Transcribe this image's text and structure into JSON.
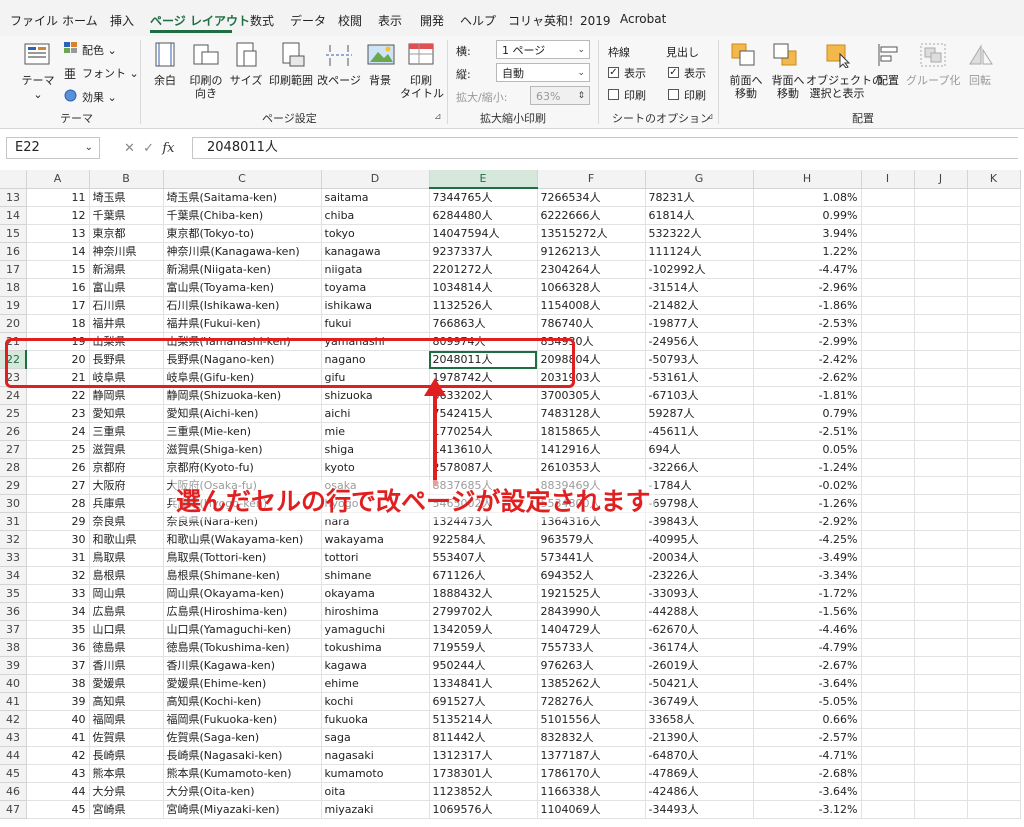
{
  "menu": [
    "ファイル",
    "ホーム",
    "挿入",
    "ページ レイアウト",
    "数式",
    "データ",
    "校閲",
    "表示",
    "開発",
    "ヘルプ",
    "コリャ英和！2019",
    "Acrobat"
  ],
  "active_tab_index": 3,
  "ribbon": {
    "theme": {
      "theme_label": "テーマ",
      "colors": "配色",
      "fonts": "フォント",
      "effects": "効果",
      "group": "テーマ"
    },
    "page_setup": {
      "margins": "余白",
      "orientation": "印刷の\n向き",
      "size": "サイズ",
      "print_area": "印刷範囲",
      "breaks": "改ページ",
      "background": "背景",
      "print_titles": "印刷\nタイトル",
      "group": "ページ設定"
    },
    "scale": {
      "width_label": "横:",
      "width_value": "1 ページ",
      "height_label": "縦:",
      "height_value": "自動",
      "scale_label": "拡大/縮小:",
      "scale_value": "63%",
      "group": "拡大縮小印刷"
    },
    "sheet_options": {
      "gridlines": "枠線",
      "headings": "見出し",
      "view": "表示",
      "print": "印刷",
      "group": "シートのオプション"
    },
    "arrange": {
      "bring_forward": "前面へ\n移動",
      "send_backward": "背面へ\n移動",
      "selection_pane": "オブジェクトの\n選択と表示",
      "align": "配置",
      "group_btn": "グループ化",
      "rotate": "回転",
      "group": "配置"
    }
  },
  "name_box": "E22",
  "formula": "2048011人",
  "columns": [
    "A",
    "B",
    "C",
    "D",
    "E",
    "F",
    "G",
    "H",
    "I",
    "J",
    "K"
  ],
  "selected_column": "E",
  "selected_row": "22",
  "rows": [
    {
      "r": "13",
      "a": "11",
      "b": "埼玉県",
      "c": "埼玉県(Saitama-ken)",
      "d": "saitama",
      "e": "7344765人",
      "f": "7266534人",
      "g": "78231人",
      "h": "1.08%"
    },
    {
      "r": "14",
      "a": "12",
      "b": "千葉県",
      "c": "千葉県(Chiba-ken)",
      "d": "chiba",
      "e": "6284480人",
      "f": "6222666人",
      "g": "61814人",
      "h": "0.99%"
    },
    {
      "r": "15",
      "a": "13",
      "b": "東京都",
      "c": "東京都(Tokyo-to)",
      "d": "tokyo",
      "e": "14047594人",
      "f": "13515272人",
      "g": "532322人",
      "h": "3.94%"
    },
    {
      "r": "16",
      "a": "14",
      "b": "神奈川県",
      "c": "神奈川県(Kanagawa-ken)",
      "d": "kanagawa",
      "e": "9237337人",
      "f": "9126213人",
      "g": "111124人",
      "h": "1.22%"
    },
    {
      "r": "17",
      "a": "15",
      "b": "新潟県",
      "c": "新潟県(Niigata-ken)",
      "d": "niigata",
      "e": "2201272人",
      "f": "2304264人",
      "g": "-102992人",
      "h": "-4.47%"
    },
    {
      "r": "18",
      "a": "16",
      "b": "富山県",
      "c": "富山県(Toyama-ken)",
      "d": "toyama",
      "e": "1034814人",
      "f": "1066328人",
      "g": "-31514人",
      "h": "-2.96%"
    },
    {
      "r": "19",
      "a": "17",
      "b": "石川県",
      "c": "石川県(Ishikawa-ken)",
      "d": "ishikawa",
      "e": "1132526人",
      "f": "1154008人",
      "g": "-21482人",
      "h": "-1.86%"
    },
    {
      "r": "20",
      "a": "18",
      "b": "福井県",
      "c": "福井県(Fukui-ken)",
      "d": "fukui",
      "e": "766863人",
      "f": "786740人",
      "g": "-19877人",
      "h": "-2.53%"
    },
    {
      "r": "21",
      "a": "19",
      "b": "山梨県",
      "c": "山梨県(Yamanashi-ken)",
      "d": "yamanashi",
      "e": "809974人",
      "f": "834930人",
      "g": "-24956人",
      "h": "-2.99%"
    },
    {
      "r": "22",
      "a": "20",
      "b": "長野県",
      "c": "長野県(Nagano-ken)",
      "d": "nagano",
      "e": "2048011人",
      "f": "2098804人",
      "g": "-50793人",
      "h": "-2.42%"
    },
    {
      "r": "23",
      "a": "21",
      "b": "岐阜県",
      "c": "岐阜県(Gifu-ken)",
      "d": "gifu",
      "e": "1978742人",
      "f": "2031903人",
      "g": "-53161人",
      "h": "-2.62%"
    },
    {
      "r": "24",
      "a": "22",
      "b": "静岡県",
      "c": "静岡県(Shizuoka-ken)",
      "d": "shizuoka",
      "e": "3633202人",
      "f": "3700305人",
      "g": "-67103人",
      "h": "-1.81%"
    },
    {
      "r": "25",
      "a": "23",
      "b": "愛知県",
      "c": "愛知県(Aichi-ken)",
      "d": "aichi",
      "e": "7542415人",
      "f": "7483128人",
      "g": "59287人",
      "h": "0.79%"
    },
    {
      "r": "26",
      "a": "24",
      "b": "三重県",
      "c": "三重県(Mie-ken)",
      "d": "mie",
      "e": "1770254人",
      "f": "1815865人",
      "g": "-45611人",
      "h": "-2.51%"
    },
    {
      "r": "27",
      "a": "25",
      "b": "滋賀県",
      "c": "滋賀県(Shiga-ken)",
      "d": "shiga",
      "e": "1413610人",
      "f": "1412916人",
      "g": "694人",
      "h": "0.05%"
    },
    {
      "r": "28",
      "a": "26",
      "b": "京都府",
      "c": "京都府(Kyoto-fu)",
      "d": "kyoto",
      "e": "2578087人",
      "f": "2610353人",
      "g": "-32266人",
      "h": "-1.24%"
    },
    {
      "r": "29",
      "a": "27",
      "b": "大阪府",
      "c": "大阪府(Osaka-fu)",
      "d": "osaka",
      "e": "8837685人",
      "f": "8839469人",
      "g": "-1784人",
      "h": "-0.02%"
    },
    {
      "r": "30",
      "a": "28",
      "b": "兵庫県",
      "c": "兵庫県(Hyogo-ken)",
      "d": "hyogo",
      "e": "5465002人",
      "f": "5534800人",
      "g": "-69798人",
      "h": "-1.26%"
    },
    {
      "r": "31",
      "a": "29",
      "b": "奈良県",
      "c": "奈良県(Nara-ken)",
      "d": "nara",
      "e": "1324473人",
      "f": "1364316人",
      "g": "-39843人",
      "h": "-2.92%"
    },
    {
      "r": "32",
      "a": "30",
      "b": "和歌山県",
      "c": "和歌山県(Wakayama-ken)",
      "d": "wakayama",
      "e": "922584人",
      "f": "963579人",
      "g": "-40995人",
      "h": "-4.25%"
    },
    {
      "r": "33",
      "a": "31",
      "b": "鳥取県",
      "c": "鳥取県(Tottori-ken)",
      "d": "tottori",
      "e": "553407人",
      "f": "573441人",
      "g": "-20034人",
      "h": "-3.49%"
    },
    {
      "r": "34",
      "a": "32",
      "b": "島根県",
      "c": "島根県(Shimane-ken)",
      "d": "shimane",
      "e": "671126人",
      "f": "694352人",
      "g": "-23226人",
      "h": "-3.34%"
    },
    {
      "r": "35",
      "a": "33",
      "b": "岡山県",
      "c": "岡山県(Okayama-ken)",
      "d": "okayama",
      "e": "1888432人",
      "f": "1921525人",
      "g": "-33093人",
      "h": "-1.72%"
    },
    {
      "r": "36",
      "a": "34",
      "b": "広島県",
      "c": "広島県(Hiroshima-ken)",
      "d": "hiroshima",
      "e": "2799702人",
      "f": "2843990人",
      "g": "-44288人",
      "h": "-1.56%"
    },
    {
      "r": "37",
      "a": "35",
      "b": "山口県",
      "c": "山口県(Yamaguchi-ken)",
      "d": "yamaguchi",
      "e": "1342059人",
      "f": "1404729人",
      "g": "-62670人",
      "h": "-4.46%"
    },
    {
      "r": "38",
      "a": "36",
      "b": "徳島県",
      "c": "徳島県(Tokushima-ken)",
      "d": "tokushima",
      "e": "719559人",
      "f": "755733人",
      "g": "-36174人",
      "h": "-4.79%"
    },
    {
      "r": "39",
      "a": "37",
      "b": "香川県",
      "c": "香川県(Kagawa-ken)",
      "d": "kagawa",
      "e": "950244人",
      "f": "976263人",
      "g": "-26019人",
      "h": "-2.67%"
    },
    {
      "r": "40",
      "a": "38",
      "b": "愛媛県",
      "c": "愛媛県(Ehime-ken)",
      "d": "ehime",
      "e": "1334841人",
      "f": "1385262人",
      "g": "-50421人",
      "h": "-3.64%"
    },
    {
      "r": "41",
      "a": "39",
      "b": "高知県",
      "c": "高知県(Kochi-ken)",
      "d": "kochi",
      "e": "691527人",
      "f": "728276人",
      "g": "-36749人",
      "h": "-5.05%"
    },
    {
      "r": "42",
      "a": "40",
      "b": "福岡県",
      "c": "福岡県(Fukuoka-ken)",
      "d": "fukuoka",
      "e": "5135214人",
      "f": "5101556人",
      "g": "33658人",
      "h": "0.66%"
    },
    {
      "r": "43",
      "a": "41",
      "b": "佐賀県",
      "c": "佐賀県(Saga-ken)",
      "d": "saga",
      "e": "811442人",
      "f": "832832人",
      "g": "-21390人",
      "h": "-2.57%"
    },
    {
      "r": "44",
      "a": "42",
      "b": "長崎県",
      "c": "長崎県(Nagasaki-ken)",
      "d": "nagasaki",
      "e": "1312317人",
      "f": "1377187人",
      "g": "-64870人",
      "h": "-4.71%"
    },
    {
      "r": "45",
      "a": "43",
      "b": "熊本県",
      "c": "熊本県(Kumamoto-ken)",
      "d": "kumamoto",
      "e": "1738301人",
      "f": "1786170人",
      "g": "-47869人",
      "h": "-2.68%"
    },
    {
      "r": "46",
      "a": "44",
      "b": "大分県",
      "c": "大分県(Oita-ken)",
      "d": "oita",
      "e": "1123852人",
      "f": "1166338人",
      "g": "-42486人",
      "h": "-3.64%"
    },
    {
      "r": "47",
      "a": "45",
      "b": "宮崎県",
      "c": "宮崎県(Miyazaki-ken)",
      "d": "miyazaki",
      "e": "1069576人",
      "f": "1104069人",
      "g": "-34493人",
      "h": "-3.12%"
    }
  ],
  "annotation": "選んだセルの行で改ページが設定されます",
  "colors": {
    "accent": "#1f6e43",
    "annotation": "#e02020"
  }
}
